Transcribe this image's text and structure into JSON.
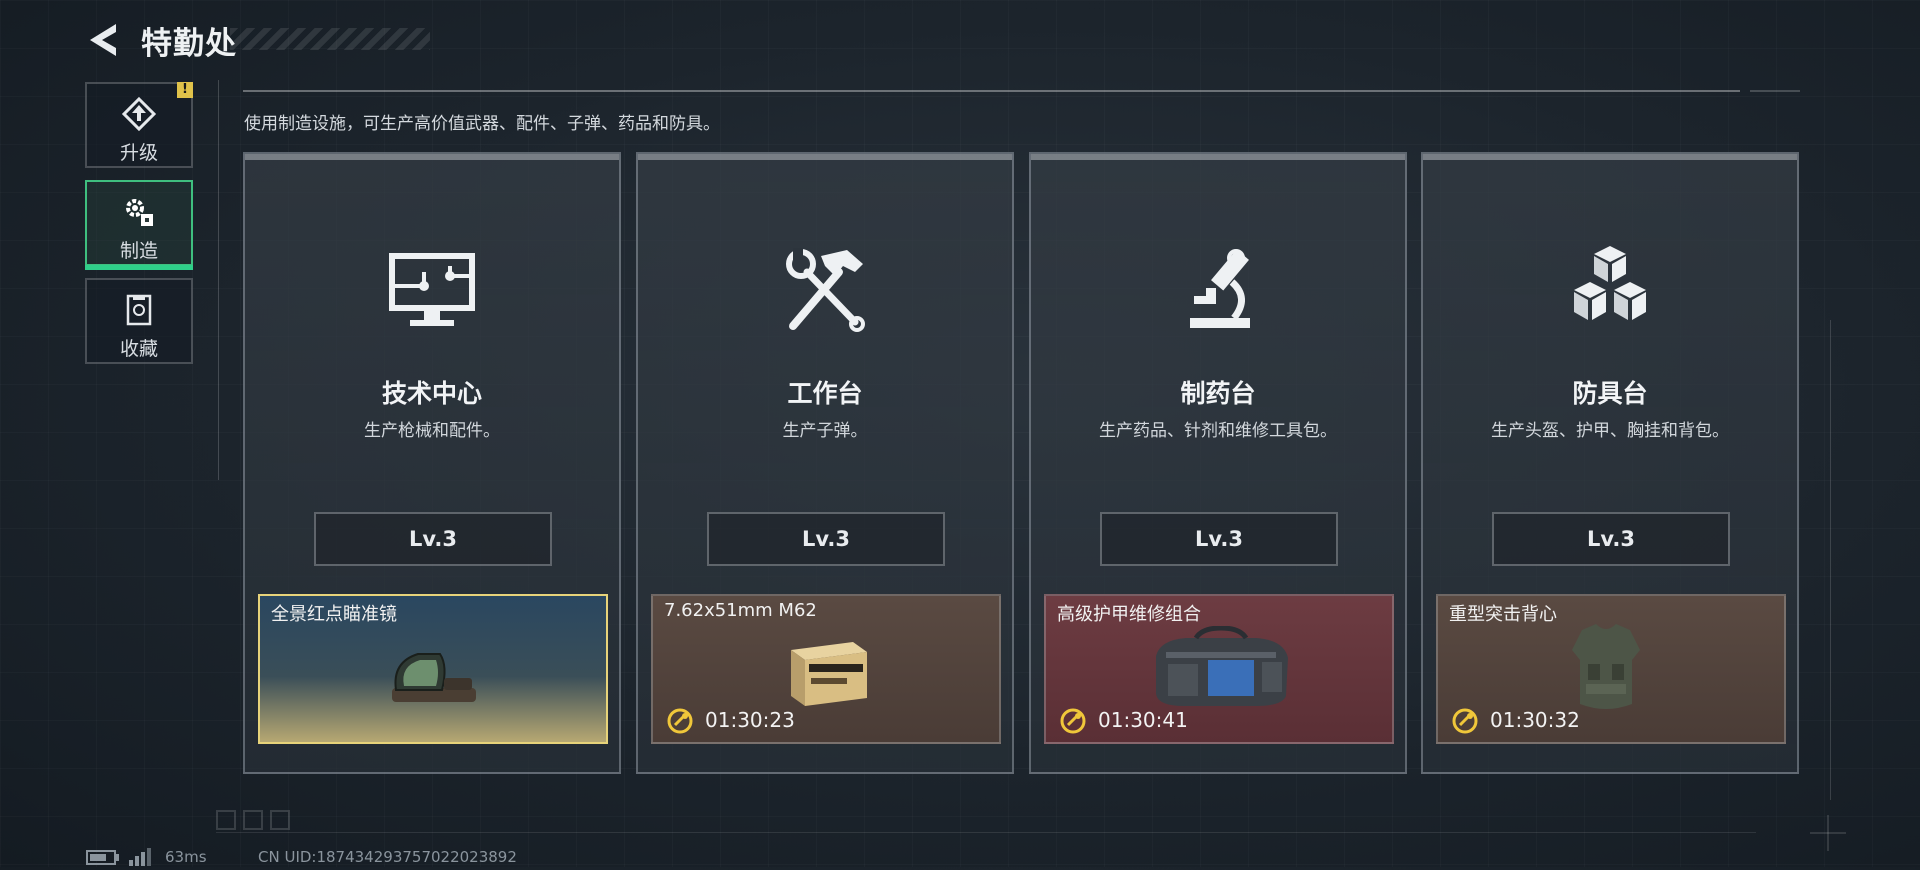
{
  "header": {
    "title": "特勤处",
    "back_icon": "back-arrow-icon"
  },
  "sidebar": {
    "tabs": [
      {
        "label": "升级",
        "icon": "upgrade-icon",
        "active": false,
        "alert": "!"
      },
      {
        "label": "制造",
        "icon": "gears-icon",
        "active": true
      },
      {
        "label": "收藏",
        "icon": "collection-icon",
        "active": false
      }
    ]
  },
  "description": "使用制造设施，可生产高价值武器、配件、子弹、药品和防具。",
  "cards": [
    {
      "icon": "monitor-circuit-icon",
      "title": "技术中心",
      "desc": "生产枪械和配件。",
      "level": "Lv.3",
      "slot": {
        "name": "全景红点瞄准镜",
        "timer": "",
        "item_icon": "red-dot-scope-icon",
        "style": "scope"
      }
    },
    {
      "icon": "hammer-wrench-icon",
      "title": "工作台",
      "desc": "生产子弹。",
      "level": "Lv.3",
      "slot": {
        "name": "7.62x51mm M62",
        "timer": "01:30:23",
        "item_icon": "ammo-box-icon",
        "style": "ammo"
      }
    },
    {
      "icon": "microscope-icon",
      "title": "制药台",
      "desc": "生产药品、针剂和维修工具包。",
      "level": "Lv.3",
      "slot": {
        "name": "高级护甲维修组合",
        "timer": "01:30:41",
        "item_icon": "repair-bag-icon",
        "style": "armorkit"
      }
    },
    {
      "icon": "cubes-icon",
      "title": "防具台",
      "desc": "生产头盔、护甲、胸挂和背包。",
      "level": "Lv.3",
      "slot": {
        "name": "重型突击背心",
        "timer": "01:30:32",
        "item_icon": "assault-vest-icon",
        "style": "vest"
      }
    }
  ],
  "status_bar": {
    "ping": "63ms",
    "uid": "CN UID:1874342937570220238​92"
  },
  "colors": {
    "accent_green": "#2fd08a",
    "alert_yellow": "#e0c24a",
    "timer_yellow": "#f0c73a"
  }
}
